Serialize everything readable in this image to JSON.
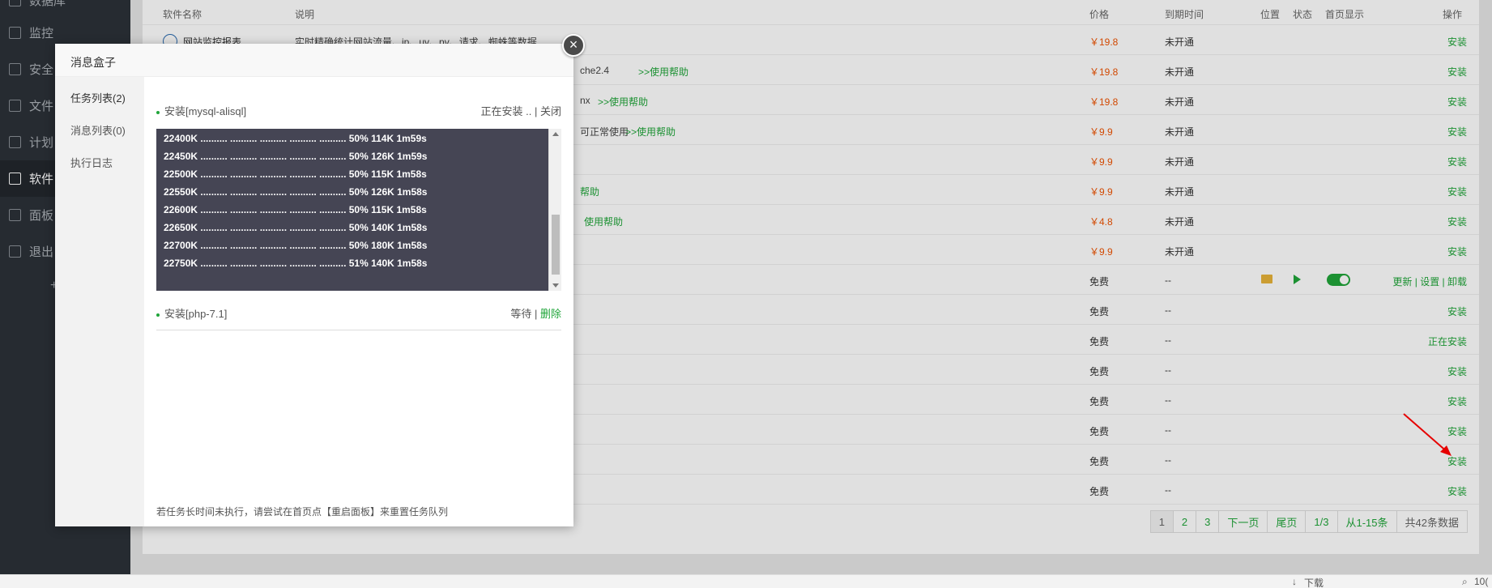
{
  "sidebar": {
    "items": [
      {
        "label": "数据库",
        "icon": "database-icon",
        "active": false
      },
      {
        "label": "监控",
        "icon": "monitor-icon",
        "active": false
      },
      {
        "label": "安全",
        "icon": "shield-icon",
        "active": false
      },
      {
        "label": "文件",
        "icon": "folder-icon",
        "active": false
      },
      {
        "label": "计划",
        "icon": "calendar-icon",
        "active": false
      },
      {
        "label": "软件",
        "icon": "grid-icon",
        "active": true
      },
      {
        "label": "面板",
        "icon": "gear-icon",
        "active": false
      },
      {
        "label": "退出",
        "icon": "logout-icon",
        "active": false
      }
    ],
    "add": "+"
  },
  "table": {
    "headers": {
      "name": "软件名称",
      "desc": "说明",
      "price": "价格",
      "expire": "到期时间",
      "position": "位置",
      "status": "状态",
      "homepage": "首页显示",
      "op": "操作"
    },
    "rows": [
      {
        "name": "网站监控报表",
        "desc": "实时精确统计网站流量、ip、uv、pv、请求、蜘蛛等数据",
        "help": "",
        "price": "￥19.8",
        "paid": true,
        "expire": "未开通",
        "op": "安装"
      },
      {
        "name": "",
        "desc": "che2.4",
        "help": ">>使用帮助",
        "price": "￥19.8",
        "paid": true,
        "expire": "未开通",
        "op": "安装"
      },
      {
        "name": "",
        "desc": "nx",
        "help": ">>使用帮助",
        "price": "￥19.8",
        "paid": true,
        "expire": "未开通",
        "op": "安装"
      },
      {
        "name": "",
        "desc": "可正常使用",
        "help": ">>使用帮助",
        "price": "￥9.9",
        "paid": true,
        "expire": "未开通",
        "op": "安装"
      },
      {
        "name": "",
        "desc": "",
        "help": "",
        "price": "￥9.9",
        "paid": true,
        "expire": "未开通",
        "op": "安装"
      },
      {
        "name": "",
        "desc": "",
        "help": "帮助",
        "price": "￥9.9",
        "paid": true,
        "expire": "未开通",
        "op": "安装"
      },
      {
        "name": "",
        "desc": "",
        "help": "使用帮助",
        "price": "￥4.8",
        "paid": true,
        "expire": "未开通",
        "op": "安装"
      },
      {
        "name": "",
        "desc": "",
        "help": "",
        "price": "￥9.9",
        "paid": true,
        "expire": "未开通",
        "op": "安装"
      },
      {
        "name": "",
        "desc": "",
        "help": "",
        "price": "免费",
        "paid": false,
        "expire": "--",
        "op": "更新 | 设置 | 卸载"
      },
      {
        "name": "",
        "desc": "",
        "help": "",
        "price": "免费",
        "paid": false,
        "expire": "--",
        "op": "安装"
      },
      {
        "name": "",
        "desc": "",
        "help": "",
        "price": "免费",
        "paid": false,
        "expire": "--",
        "op": "正在安装"
      },
      {
        "name": "",
        "desc": "",
        "help": "",
        "price": "免费",
        "paid": false,
        "expire": "--",
        "op": "安装"
      },
      {
        "name": "",
        "desc": "",
        "help": "",
        "price": "免费",
        "paid": false,
        "expire": "--",
        "op": "安装"
      },
      {
        "name": "",
        "desc": "",
        "help": "",
        "price": "免费",
        "paid": false,
        "expire": "--",
        "op": "安装"
      },
      {
        "name": "",
        "desc": "",
        "help": "",
        "price": "免费",
        "paid": false,
        "expire": "--",
        "op": "安装"
      },
      {
        "name": "",
        "desc": "",
        "help": "",
        "price": "免费",
        "paid": false,
        "expire": "--",
        "op": "安装"
      }
    ]
  },
  "pager": {
    "p1": "1",
    "p2": "2",
    "p3": "3",
    "next": "下一页",
    "last": "尾页",
    "pageinfo": "1/3",
    "range": "从1-15条",
    "total": "共42条数据"
  },
  "dialog": {
    "title": "消息盒子",
    "close": "×",
    "tabs": [
      "任务列表(2)",
      "消息列表(0)",
      "执行日志"
    ],
    "task1": {
      "name": "安装[mysql-alisql]",
      "status": "正在安装 ..",
      "action": "| 关闭"
    },
    "log": [
      "22400K .......... .......... .......... .......... .......... 50% 114K 1m59s",
      "22450K .......... .......... .......... .......... .......... 50% 126K 1m59s",
      "22500K .......... .......... .......... .......... .......... 50% 115K 1m58s",
      "22550K .......... .......... .......... .......... .......... 50% 126K 1m58s",
      "22600K .......... .......... .......... .......... .......... 50% 115K 1m58s",
      "22650K .......... .......... .......... .......... .......... 50% 140K 1m58s",
      "22700K .......... .......... .......... .......... .......... 50% 180K 1m58s",
      "22750K .......... .......... .......... .......... .......... 51% 140K 1m58s"
    ],
    "task2": {
      "name": "安装[php-7.1]",
      "status": "等待",
      "sep": "|",
      "action": "删除"
    },
    "note": "若任务长时间未执行，请尝试在首页点【重启面板】来重置任务队列"
  },
  "statusbar": {
    "download": "下载",
    "zoom": "10("
  }
}
